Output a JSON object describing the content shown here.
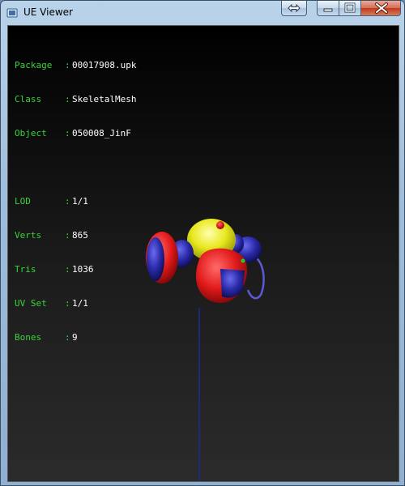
{
  "window": {
    "title": "UE Viewer"
  },
  "mesh_info": [
    {
      "label": "Package",
      "value": "00017908.upk"
    },
    {
      "label": "Class",
      "value": "SkeletalMesh"
    },
    {
      "label": "Object",
      "value": "050008_JinF"
    }
  ],
  "stats": [
    {
      "label": "LOD",
      "value": "1/1"
    },
    {
      "label": "Verts",
      "value": "865"
    },
    {
      "label": "Tris",
      "value": "1036"
    },
    {
      "label": "UV Set",
      "value": "1/1"
    },
    {
      "label": "Bones",
      "value": "9"
    }
  ],
  "separator": ":",
  "colors": {
    "label_green": "#39d33c",
    "value_white": "#ffffff",
    "mesh_red": "#e21a1a",
    "mesh_blue": "#2a2aa8",
    "mesh_yellow": "#e8e81e",
    "axis_blue": "#1c2a9a"
  },
  "icons": {
    "app": "ue-viewer-icon",
    "extra": "resize-arrows-icon",
    "minimize": "minimize-icon",
    "maximize": "maximize-icon",
    "close": "close-icon"
  }
}
